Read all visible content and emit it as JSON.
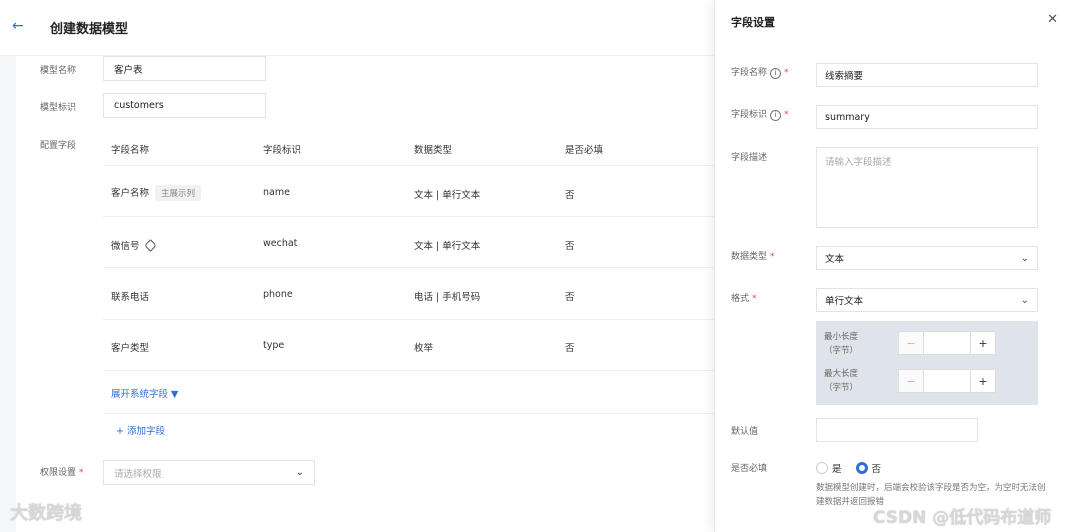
{
  "header": {
    "back_icon": "arrow-left-icon",
    "title": "创建数据模型"
  },
  "form": {
    "model_name_label": "模型名称",
    "model_name_value": "客户表",
    "model_id_label": "模型标识",
    "model_id_value": "customers",
    "fields_label": "配置字段",
    "permission_label": "权限设置",
    "permission_placeholder": "请选择权限"
  },
  "table": {
    "headers": [
      "字段名称",
      "字段标识",
      "数据类型",
      "是否必填"
    ],
    "rows": [
      {
        "name": "客户名称",
        "tag": "主展示列",
        "id": "name",
        "type": "文本 | 单行文本",
        "required": "否"
      },
      {
        "name": "微信号",
        "id": "wechat",
        "type": "文本 | 单行文本",
        "required": "否"
      },
      {
        "name": "联系电话",
        "id": "phone",
        "type": "电话 | 手机号码",
        "required": "否"
      },
      {
        "name": "客户类型",
        "id": "type",
        "type": "枚举",
        "required": "否"
      }
    ],
    "expand_label": "展开系统字段 ▼",
    "add_label": "+ 添加字段"
  },
  "watermarks": {
    "left": "大数跨境",
    "right": "CSDN @低代码布道师"
  },
  "panel": {
    "title": "字段设置",
    "close_icon": "close-icon",
    "field_name_label": "字段名称",
    "field_name_value": "线索摘要",
    "field_id_label": "字段标识",
    "field_id_value": "summary",
    "desc_label": "字段描述",
    "desc_placeholder": "请输入字段描述",
    "data_type_label": "数据类型",
    "data_type_value": "文本",
    "format_label": "格式",
    "format_value": "单行文本",
    "min_len_label": "最小长度",
    "max_len_label": "最大长度",
    "unit_label": "（字节）",
    "default_label": "默认值",
    "required_label": "是否必填",
    "yes_label": "是",
    "no_label": "否",
    "required_selected": "否",
    "hint": "数据模型创建时，后端会校验该字段是否为空，为空时无法创建数据并返回报错"
  }
}
